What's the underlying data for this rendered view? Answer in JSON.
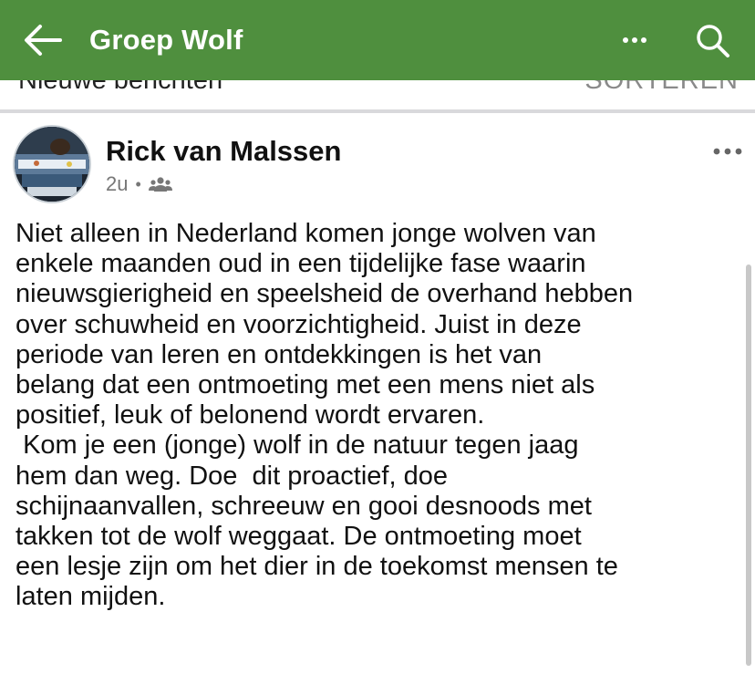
{
  "header": {
    "title": "Groep Wolf",
    "icons": {
      "back": "arrow-left",
      "more": "ellipsis-horizontal",
      "search": "magnifier"
    },
    "background_color": "#4f8f3e"
  },
  "subbar": {
    "label": "Nieuwe berichten",
    "sort_label": "SORTEREN"
  },
  "post": {
    "author": "Rick van Malssen",
    "time": "2u",
    "separator": "•",
    "audience_icon": "group-icon",
    "body": "Niet alleen in Nederland komen jonge wolven van\nenkele maanden oud in een tijdelijke fase waarin\nnieuwsgierigheid en speelsheid de overhand hebben\nover schuwheid en voorzichtigheid. Juist in deze\nperiode van leren en ontdekkingen is het van\nbelang dat een ontmoeting met een mens niet als\npositief, leuk of belonend wordt ervaren.\n Kom je een (jonge) wolf in de natuur tegen jaag\nhem dan weg. Doe  dit proactief, doe\nschijnaanvallen, schreeuw en gooi desnoods met\ntakken tot de wolf weggaat. De ontmoeting moet\neen lesje zijn om het dier in de toekomst mensen te\nlaten mijden."
  }
}
